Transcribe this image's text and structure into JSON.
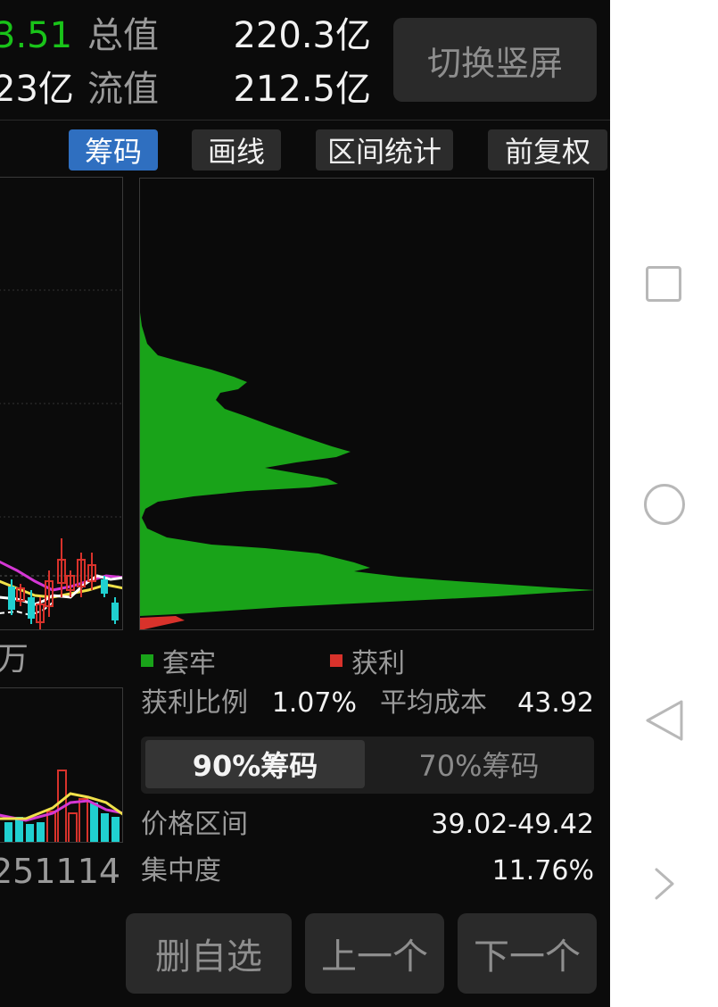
{
  "header": {
    "price_partial": "3.51",
    "amount_partial": "23亿",
    "total_value_label": "总值",
    "total_value": "220.3亿",
    "float_value_label": "流值",
    "float_value": "212.5亿",
    "switch_button": "切换竖屏"
  },
  "tabs": [
    {
      "label": "筹码",
      "active": true
    },
    {
      "label": "画线",
      "active": false
    },
    {
      "label": "区间统计",
      "active": false
    },
    {
      "label": "前复权",
      "active": false
    }
  ],
  "left_panel": {
    "volume_unit_partial": "万",
    "date_partial": "251114"
  },
  "legend": {
    "trapped_label": "套牢",
    "profit_label": "获利",
    "trapped_color": "#19a319",
    "profit_color": "#d8322b"
  },
  "stats": {
    "profit_ratio_label": "获利比例",
    "profit_ratio": "1.07%",
    "avg_cost_label": "平均成本",
    "avg_cost": "43.92",
    "price_range_label": "价格区间",
    "price_range": "39.02-49.42",
    "concentration_label": "集中度",
    "concentration": "11.76%"
  },
  "chip_toggle": {
    "option_90": "90%筹码",
    "option_70": "70%筹码",
    "selected": "90%筹码"
  },
  "bottom_buttons": {
    "delete": "删自选",
    "prev": "上一个",
    "next": "下一个"
  },
  "nav_icons": [
    "recent-apps-icon",
    "home-icon",
    "back-icon",
    "more-icon"
  ]
}
